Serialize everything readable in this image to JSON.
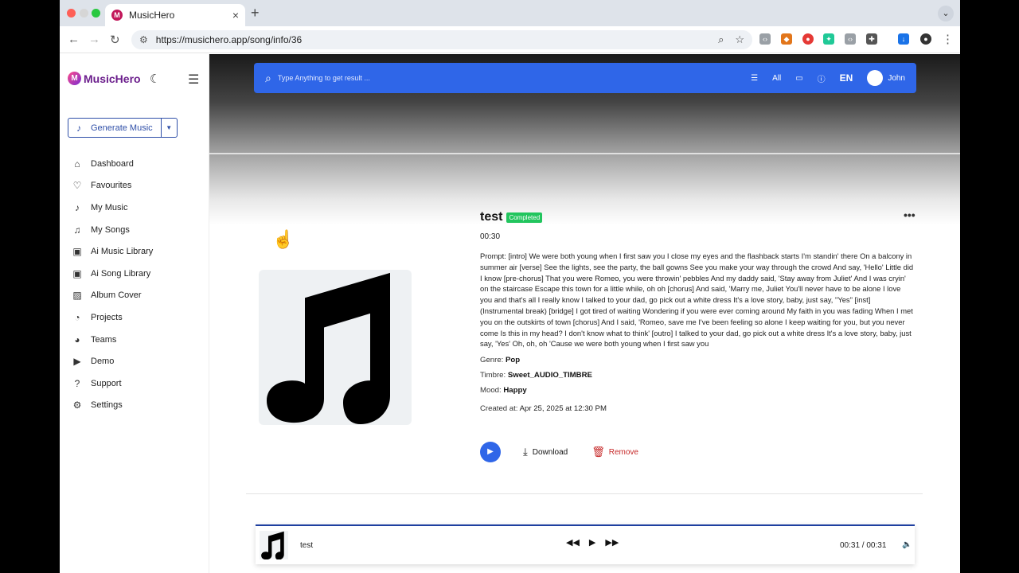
{
  "browser": {
    "tab_title": "MusicHero",
    "tab_close": "×",
    "new_tab": "+",
    "tab_menu": "⌄",
    "url": "https://musichero.app/song/info/36"
  },
  "app": {
    "logo_letter": "M",
    "logo_text": "MusicHero",
    "generate_label": "Generate Music",
    "menu": [
      {
        "label": "Dashboard",
        "icon": "home-icon"
      },
      {
        "label": "Favourites",
        "icon": "heart-icon"
      },
      {
        "label": "My Music",
        "icon": "music-note-icon"
      },
      {
        "label": "My Songs",
        "icon": "music-notes-icon"
      },
      {
        "label": "Ai Music Library",
        "icon": "library-icon"
      },
      {
        "label": "Ai Song Library",
        "icon": "library-icon"
      },
      {
        "label": "Album Cover",
        "icon": "image-icon"
      },
      {
        "label": "Projects",
        "icon": "chart-pie-icon"
      },
      {
        "label": "Teams",
        "icon": "pie-icon"
      },
      {
        "label": "Demo",
        "icon": "play-square-icon"
      },
      {
        "label": "Support",
        "icon": "help-icon"
      },
      {
        "label": "Settings",
        "icon": "gear-icon"
      }
    ]
  },
  "search": {
    "placeholder": "Type Anything to get result ...",
    "filter": "All",
    "lang": "EN",
    "user": "John"
  },
  "song": {
    "title": "test",
    "status": "Completed",
    "duration": "00:30",
    "prompt_label": "Prompt:",
    "prompt": "[intro] We were both young when I first saw you I close my eyes and the flashback starts I'm standin' there On a balcony in summer air [verse] See the lights, see the party, the ball gowns See you make your way through the crowd And say, 'Hello' Little did I know [pre-chorus] That you were Romeo, you were throwin' pebbles And my daddy said, 'Stay away from Juliet' And I was cryin' on the staircase Escape this town for a little while, oh oh [chorus] And said, 'Marry me, Juliet You'll never have to be alone I love you and that's all I really know I talked to your dad, go pick out a white dress It's a love story, baby, just say, \"Yes\" [inst] (Instrumental break) [bridge] I got tired of waiting Wondering if you were ever coming around My faith in you was fading When I met you on the outskirts of town [chorus] And I said, 'Romeo, save me I've been feeling so alone I keep waiting for you, but you never come Is this in my head? I don't know what to think' [outro] I talked to your dad, go pick out a white dress It's a love story, baby, just say, 'Yes' Oh, oh, oh 'Cause we were both young when I first saw you",
    "genre_label": "Genre:",
    "genre": "Pop",
    "timbre_label": "Timbre:",
    "timbre": "Sweet_AUDIO_TIMBRE",
    "mood_label": "Mood:",
    "mood": "Happy",
    "created_label": "Created at:",
    "created": "Apr 25, 2025 at 12:30 PM",
    "download_label": "Download",
    "remove_label": "Remove"
  },
  "player": {
    "title": "test",
    "time": "00:31 / 00:31"
  }
}
